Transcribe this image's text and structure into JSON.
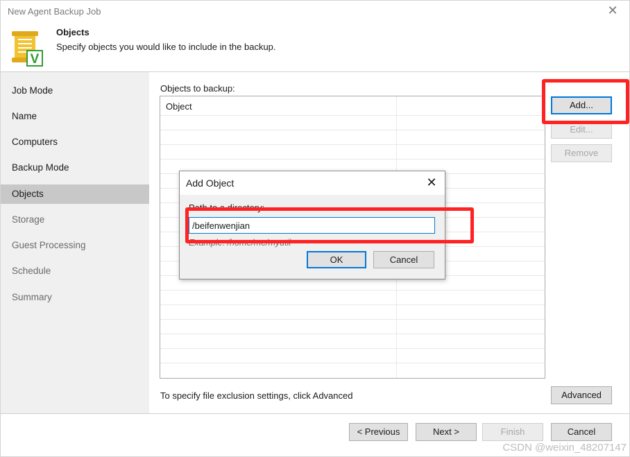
{
  "window": {
    "title": "New Agent Backup Job",
    "close_glyph": "✕"
  },
  "header": {
    "title": "Objects",
    "subtitle": "Specify objects you would like to include in the backup.",
    "icon": "veeam-scroll-check-icon",
    "icon_mark": "V"
  },
  "sidebar": {
    "items": [
      {
        "label": "Job Mode",
        "state": "done"
      },
      {
        "label": "Name",
        "state": "done"
      },
      {
        "label": "Computers",
        "state": "done"
      },
      {
        "label": "Backup Mode",
        "state": "done"
      },
      {
        "label": "Objects",
        "state": "active"
      },
      {
        "label": "Storage",
        "state": "pending"
      },
      {
        "label": "Guest Processing",
        "state": "pending"
      },
      {
        "label": "Schedule",
        "state": "pending"
      },
      {
        "label": "Summary",
        "state": "pending"
      }
    ]
  },
  "main": {
    "objects_label": "Objects to backup:",
    "table": {
      "columns": [
        "Object",
        ""
      ],
      "rows": []
    },
    "buttons": {
      "add": "Add...",
      "edit": "Edit...",
      "remove": "Remove",
      "advanced": "Advanced"
    },
    "info_text": "To specify file exclusion settings, click Advanced"
  },
  "dialog": {
    "title": "Add Object",
    "close_glyph": "✕",
    "field_label": "Path to a directory:",
    "field_value": "/beifenwenjian",
    "example": "Example: /home/me/myutil",
    "ok": "OK",
    "cancel": "Cancel"
  },
  "footer": {
    "previous": "< Previous",
    "next": "Next >",
    "finish": "Finish",
    "cancel": "Cancel"
  },
  "colors": {
    "highlight": "#ff2222",
    "sidebar_bg": "#f0f0f0",
    "sidebar_active": "#c8c8c8",
    "icon_check": "#2e9e2e",
    "icon_scroll": "#f2c230",
    "focus": "#0078d7"
  },
  "watermark": "CSDN @weixin_48207147"
}
